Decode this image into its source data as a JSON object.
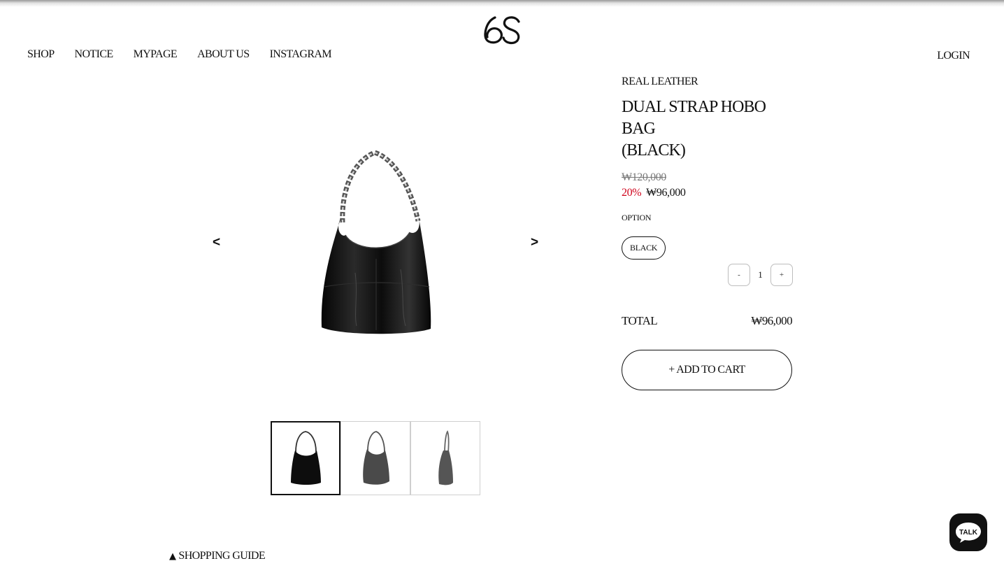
{
  "header": {
    "logo_icon": "os-logo-icon",
    "nav": [
      "SHOP",
      "NOTICE",
      "MYPAGE",
      "ABOUT US",
      "INSTAGRAM"
    ],
    "login_label": "LOGIN"
  },
  "gallery": {
    "prev_label": "<",
    "next_label": ">",
    "main_image_icon": "black-hobo-bag-image",
    "thumbnails": [
      "bag-front-thumb",
      "bag-angle-thumb",
      "bag-side-thumb"
    ],
    "active_thumbnail": 1
  },
  "product": {
    "category": "REAL LEATHER",
    "title_line1": "DUAL STRAP HOBO BAG",
    "title_line2": "(BLACK)",
    "original_price": "₩120,000",
    "discount": "20%",
    "sale_price": "₩96,000",
    "option_label": "OPTION",
    "option_selected": "BLACK",
    "qty_minus": "-",
    "qty_value": "1",
    "qty_plus": "+",
    "total_label": "TOTAL",
    "total_value": "₩96,000",
    "add_to_cart_label": "+ ADD TO CART"
  },
  "footer": {
    "guide_icon": "▲",
    "guide_label": "SHOPPING GUIDE"
  },
  "chat": {
    "icon": "talk-chat-icon",
    "label": "TALK"
  },
  "colors": {
    "text": "#111111",
    "discount": "#d0021b",
    "muted": "#777777",
    "border": "#cfcfcf"
  }
}
